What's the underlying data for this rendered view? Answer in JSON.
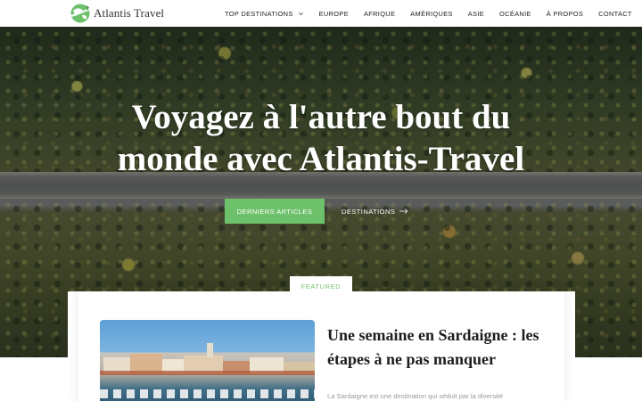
{
  "brand": {
    "name": "Atlantis Travel",
    "logo_icon": "globe-plane-icon",
    "accent": "#6ec16b"
  },
  "nav": {
    "items": [
      {
        "label": "TOP DESTINATIONS",
        "has_dropdown": true
      },
      {
        "label": "EUROPE"
      },
      {
        "label": "AFRIQUE"
      },
      {
        "label": "AMÉRIQUES"
      },
      {
        "label": "ASIE"
      },
      {
        "label": "OCÉANIE"
      },
      {
        "label": "À PROPOS"
      },
      {
        "label": "CONTACT"
      }
    ]
  },
  "hero": {
    "title_line1": "Voyagez à l'autre bout du",
    "title_line2": "monde avec Atlantis-Travel",
    "primary_button": "DERNIERS ARTICLES",
    "secondary_button": "DESTINATIONS",
    "secondary_icon": "arrow-right-icon"
  },
  "featured": {
    "tag": "FEATURED",
    "title": "Une semaine en Sardaigne : les étapes à ne pas manquer",
    "excerpt": "La Sardaigne est une destination qui séduit par la diversité"
  }
}
